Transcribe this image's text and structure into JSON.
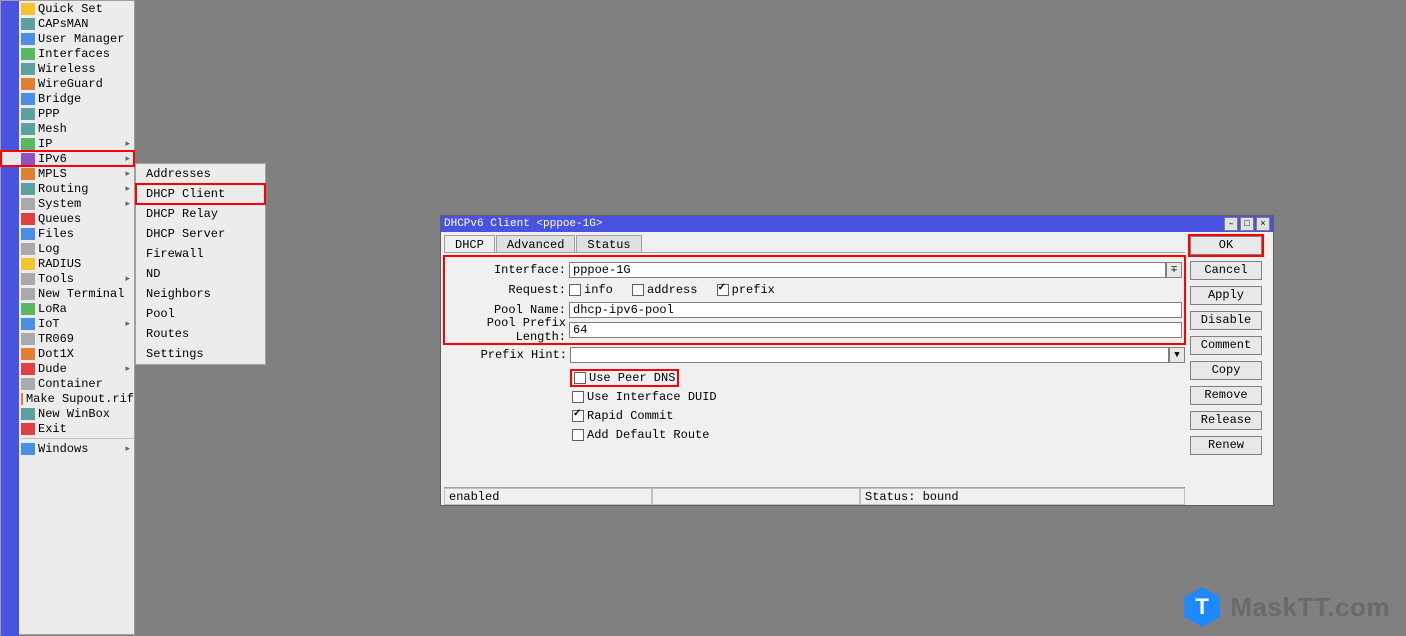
{
  "sidebar": {
    "items": [
      {
        "label": "Quick Set",
        "icon": "wand",
        "cls": "i-yellow"
      },
      {
        "label": "CAPsMAN",
        "icon": "antenna",
        "cls": "i-teal"
      },
      {
        "label": "User Manager",
        "icon": "users",
        "cls": "i-blue"
      },
      {
        "label": "Interfaces",
        "icon": "interfaces",
        "cls": "i-green"
      },
      {
        "label": "Wireless",
        "icon": "wifi",
        "cls": "i-teal"
      },
      {
        "label": "WireGuard",
        "icon": "wireguard",
        "cls": "i-orange"
      },
      {
        "label": "Bridge",
        "icon": "bridge",
        "cls": "i-blue"
      },
      {
        "label": "PPP",
        "icon": "ppp",
        "cls": "i-teal"
      },
      {
        "label": "Mesh",
        "icon": "mesh",
        "cls": "i-teal"
      },
      {
        "label": "IP",
        "icon": "ip",
        "cls": "i-green",
        "arrow": true
      },
      {
        "label": "IPv6",
        "icon": "ipv6",
        "cls": "i-purple",
        "arrow": true,
        "highlight": true
      },
      {
        "label": "MPLS",
        "icon": "mpls",
        "cls": "i-orange",
        "arrow": true
      },
      {
        "label": "Routing",
        "icon": "routing",
        "cls": "i-teal",
        "arrow": true
      },
      {
        "label": "System",
        "icon": "system",
        "cls": "i-grey",
        "arrow": true
      },
      {
        "label": "Queues",
        "icon": "queues",
        "cls": "i-red"
      },
      {
        "label": "Files",
        "icon": "files",
        "cls": "i-blue"
      },
      {
        "label": "Log",
        "icon": "log",
        "cls": "i-grey"
      },
      {
        "label": "RADIUS",
        "icon": "radius",
        "cls": "i-yellow"
      },
      {
        "label": "Tools",
        "icon": "tools",
        "cls": "i-grey",
        "arrow": true
      },
      {
        "label": "New Terminal",
        "icon": "terminal",
        "cls": "i-grey"
      },
      {
        "label": "LoRa",
        "icon": "lora",
        "cls": "i-green"
      },
      {
        "label": "IoT",
        "icon": "iot",
        "cls": "i-blue",
        "arrow": true
      },
      {
        "label": "TR069",
        "icon": "tr069",
        "cls": "i-grey"
      },
      {
        "label": "Dot1X",
        "icon": "dot1x",
        "cls": "i-orange"
      },
      {
        "label": "Dude",
        "icon": "dude",
        "cls": "i-red",
        "arrow": true
      },
      {
        "label": "Container",
        "icon": "container",
        "cls": "i-grey"
      },
      {
        "label": "Make Supout.rif",
        "icon": "supout",
        "cls": "i-orange"
      },
      {
        "label": "New WinBox",
        "icon": "winbox",
        "cls": "i-teal"
      },
      {
        "label": "Exit",
        "icon": "exit",
        "cls": "i-red"
      }
    ],
    "windows_label": "Windows"
  },
  "submenu": {
    "items": [
      {
        "label": "Addresses"
      },
      {
        "label": "DHCP Client",
        "highlight": true
      },
      {
        "label": "DHCP Relay"
      },
      {
        "label": "DHCP Server"
      },
      {
        "label": "Firewall"
      },
      {
        "label": "ND"
      },
      {
        "label": "Neighbors"
      },
      {
        "label": "Pool"
      },
      {
        "label": "Routes"
      },
      {
        "label": "Settings"
      }
    ]
  },
  "dialog": {
    "title": "DHCPv6 Client <pppoe-1G>",
    "tabs": [
      {
        "label": "DHCP"
      },
      {
        "label": "Advanced"
      },
      {
        "label": "Status"
      }
    ],
    "active_tab": 0,
    "labels": {
      "interface": "Interface:",
      "request": "Request:",
      "pool_name": "Pool Name:",
      "pool_prefix_length": "Pool Prefix Length:",
      "prefix_hint": "Prefix Hint:"
    },
    "values": {
      "interface": "pppoe-1G",
      "pool_name": "dhcp-ipv6-pool",
      "pool_prefix_length": "64",
      "prefix_hint": ""
    },
    "request": {
      "info": false,
      "address": false,
      "prefix": true,
      "info_label": "info",
      "address_label": "address",
      "prefix_label": "prefix"
    },
    "checks": {
      "use_peer_dns": {
        "label": "Use Peer DNS",
        "value": false,
        "highlight": true
      },
      "use_interface_duid": {
        "label": "Use Interface DUID",
        "value": false
      },
      "rapid_commit": {
        "label": "Rapid Commit",
        "value": true
      },
      "add_default_route": {
        "label": "Add Default Route",
        "value": false
      }
    },
    "buttons": {
      "ok": "OK",
      "cancel": "Cancel",
      "apply": "Apply",
      "disable": "Disable",
      "comment": "Comment",
      "copy": "Copy",
      "remove": "Remove",
      "release": "Release",
      "renew": "Renew"
    },
    "status": {
      "enabled": "enabled",
      "bound": "Status: bound"
    }
  },
  "watermark": {
    "badge": "T",
    "text": "MaskTT.com"
  }
}
